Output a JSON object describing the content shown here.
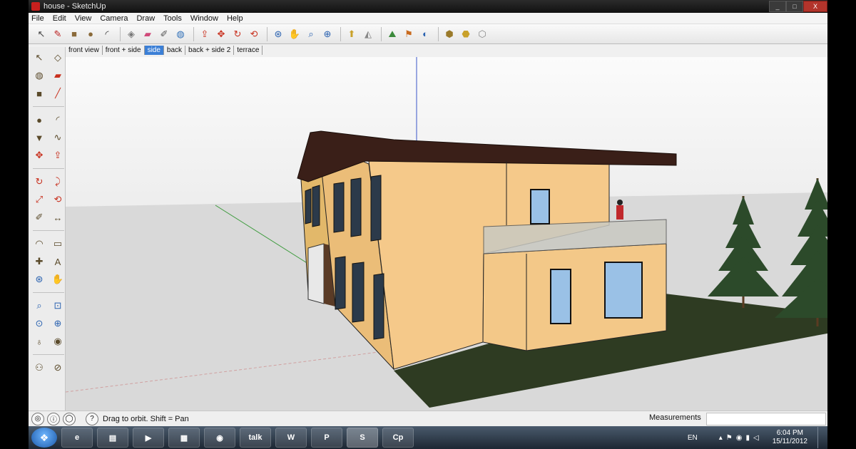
{
  "window": {
    "title": "house - SketchUp",
    "controls": [
      "_",
      "□",
      "X"
    ]
  },
  "menu": [
    "File",
    "Edit",
    "View",
    "Camera",
    "Draw",
    "Tools",
    "Window",
    "Help"
  ],
  "toolbar": {
    "icons": [
      "select-icon",
      "pencil-icon",
      "rectangle-icon",
      "circle-icon",
      "arc-icon",
      "sep",
      "make-component-icon",
      "eraser-icon",
      "tape-measure-icon",
      "paint-bucket-icon",
      "sep",
      "push-pull-icon",
      "move-icon",
      "rotate-icon",
      "offset-icon",
      "sep",
      "orbit-icon",
      "pan-icon",
      "zoom-icon",
      "zoom-extents-icon",
      "sep",
      "add-location-icon",
      "toggle-terrain-icon",
      "sep",
      "preview-google-earth-icon",
      "get-models-icon",
      "share-model-icon",
      "sep",
      "get-photo-texture-icon",
      "share-component-icon",
      "warehouse-icon"
    ],
    "glyphs": {
      "select-icon": "↖",
      "pencil-icon": "✎",
      "rectangle-icon": "■",
      "circle-icon": "●",
      "arc-icon": "◜",
      "make-component-icon": "◈",
      "eraser-icon": "▰",
      "tape-measure-icon": "✐",
      "paint-bucket-icon": "◍",
      "push-pull-icon": "⇪",
      "move-icon": "✥",
      "rotate-icon": "↻",
      "offset-icon": "⟲",
      "orbit-icon": "⊛",
      "pan-icon": "✋",
      "zoom-icon": "⌕",
      "zoom-extents-icon": "⊕",
      "add-location-icon": "⬆",
      "toggle-terrain-icon": "◭",
      "preview-google-earth-icon": "⛰",
      "get-models-icon": "⚑",
      "share-model-icon": "◐",
      "get-photo-texture-icon": "⬢",
      "share-component-icon": "⬣",
      "warehouse-icon": "⬡"
    },
    "colors": {
      "select-icon": "#444",
      "pencil-icon": "#b22",
      "rectangle-icon": "#8a6a3a",
      "circle-icon": "#8a6a3a",
      "arc-icon": "#333",
      "make-component-icon": "#777",
      "eraser-icon": "#d04a7a",
      "tape-measure-icon": "#555",
      "paint-bucket-icon": "#2f6fb7",
      "push-pull-icon": "#c8301e",
      "move-icon": "#c8301e",
      "rotate-icon": "#c8301e",
      "offset-icon": "#c8301e",
      "orbit-icon": "#2a62b0",
      "pan-icon": "#555",
      "zoom-icon": "#2a62b0",
      "zoom-extents-icon": "#2a62b0",
      "add-location-icon": "#c9a12a",
      "toggle-terrain-icon": "#888",
      "preview-google-earth-icon": "#3c8a3c",
      "get-models-icon": "#c96a1e",
      "share-model-icon": "#2a62b0",
      "get-photo-texture-icon": "#9a7a2a",
      "share-component-icon": "#c9a12a",
      "warehouse-icon": "#888"
    }
  },
  "scenes": [
    {
      "label": "front view",
      "active": false
    },
    {
      "label": "front + side",
      "active": false
    },
    {
      "label": "side",
      "active": true
    },
    {
      "label": "back",
      "active": false
    },
    {
      "label": "back + side 2",
      "active": false
    },
    {
      "label": "terrace",
      "active": false
    }
  ],
  "left_tools": [
    [
      "select-icon",
      "make-component-icon"
    ],
    [
      "paint-bucket-icon",
      "eraser-icon"
    ],
    [
      "rectangle-icon",
      "line-icon"
    ],
    [
      "circle-icon",
      "arc-icon"
    ],
    [
      "polygon-icon",
      "freehand-icon"
    ],
    [
      "move-icon",
      "push-pull-icon"
    ],
    [
      "rotate-icon",
      "follow-me-icon"
    ],
    [
      "scale-icon",
      "offset-icon"
    ],
    [
      "tape-measure-icon",
      "dimensions-icon"
    ],
    [
      "protractor-icon",
      "text-icon"
    ],
    [
      "axes-icon",
      "3d-text-icon"
    ],
    [
      "orbit-icon",
      "pan-icon"
    ],
    [
      "zoom-icon",
      "zoom-window-icon"
    ],
    [
      "previous-view-icon",
      "zoom-extents-icon"
    ],
    [
      "position-camera-icon",
      "look-around-icon"
    ],
    [
      "walk-icon",
      "section-plane-icon"
    ]
  ],
  "left_glyphs": {
    "select-icon": "↖",
    "make-component-icon": "◇",
    "paint-bucket-icon": "◍",
    "eraser-icon": "▰",
    "rectangle-icon": "■",
    "line-icon": "╱",
    "circle-icon": "●",
    "arc-icon": "◜",
    "polygon-icon": "▼",
    "freehand-icon": "∿",
    "move-icon": "✥",
    "push-pull-icon": "⇪",
    "rotate-icon": "↻",
    "follow-me-icon": "⤸",
    "scale-icon": "⤢",
    "offset-icon": "⟲",
    "tape-measure-icon": "✐",
    "dimensions-icon": "↔",
    "protractor-icon": "◠",
    "text-icon": "▭",
    "axes-icon": "✚",
    "3d-text-icon": "A",
    "orbit-icon": "⊛",
    "pan-icon": "✋",
    "zoom-icon": "⌕",
    "zoom-window-icon": "⊡",
    "previous-view-icon": "⊙",
    "zoom-extents-icon": "⊕",
    "position-camera-icon": "♁",
    "look-around-icon": "◉",
    "walk-icon": "⚇",
    "section-plane-icon": "⊘"
  },
  "status": {
    "text": "Drag to orbit.  Shift = Pan",
    "measurements_label": "Measurements",
    "measurements_value": ""
  },
  "taskbar": {
    "items": [
      {
        "name": "ie-icon",
        "label": "e"
      },
      {
        "name": "explorer-icon",
        "label": "▤"
      },
      {
        "name": "media-player-icon",
        "label": "▶"
      },
      {
        "name": "calculator-icon",
        "label": "▦"
      },
      {
        "name": "firefox-icon",
        "label": "◉"
      },
      {
        "name": "gtalk-icon",
        "label": "talk"
      },
      {
        "name": "word-icon",
        "label": "W"
      },
      {
        "name": "powerpoint-icon",
        "label": "P"
      },
      {
        "name": "sketchup-icon",
        "label": "S"
      },
      {
        "name": "captivate-icon",
        "label": "Cp"
      }
    ],
    "language": "EN",
    "time": "6:04 PM",
    "date": "15/11/2012"
  }
}
